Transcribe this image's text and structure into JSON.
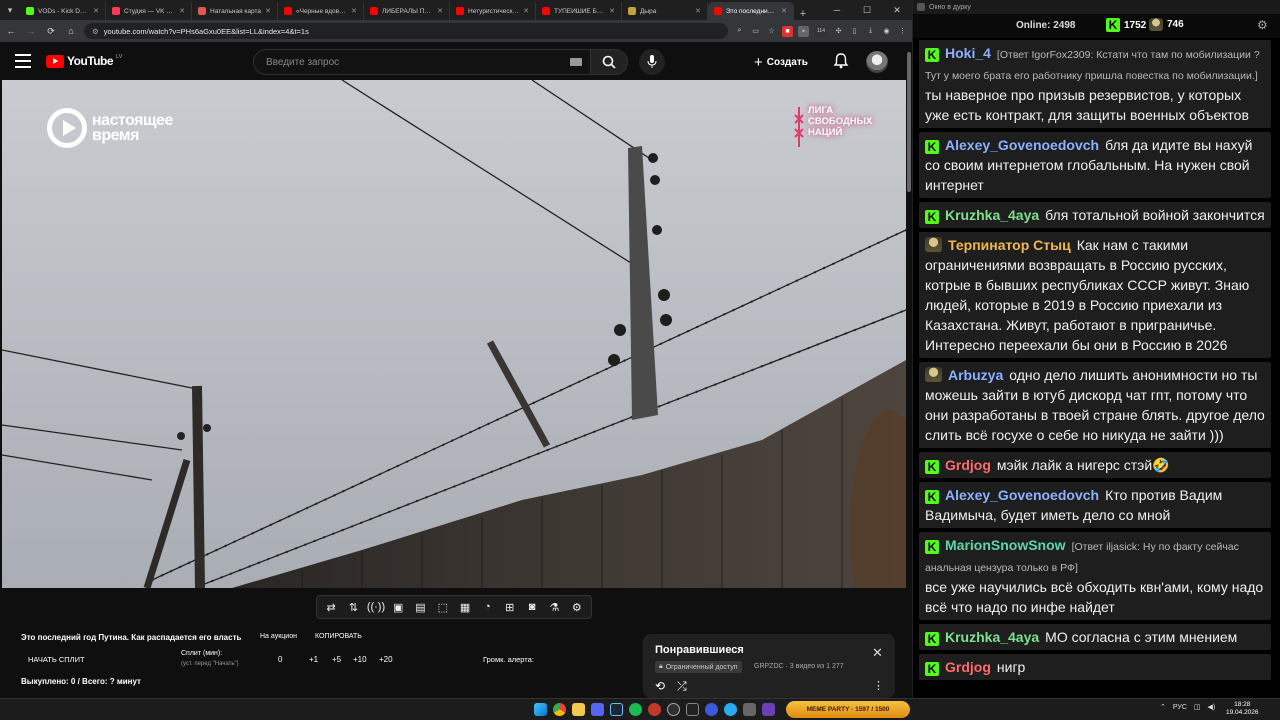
{
  "browser": {
    "tabs": [
      {
        "label": "VODs - Kick Dashb",
        "color": "#53fc18"
      },
      {
        "label": "Студия — VK Видео",
        "color": "#ff3b5c"
      },
      {
        "label": "Натальная карта",
        "color": "#e05757"
      },
      {
        "label": "«Черные вдовы»",
        "color": "#ff0000"
      },
      {
        "label": "ЛИБЕРАЛЫ ПРАВ",
        "color": "#ff0000"
      },
      {
        "label": "Нетуристический",
        "color": "#ff0000"
      },
      {
        "label": "ТУПЕЙШИЕ БЕЛЫ",
        "color": "#ff0000"
      },
      {
        "label": "Дыра",
        "color": "#c9a13b"
      },
      {
        "label": "Это последний го",
        "color": "#ff0000",
        "active": true
      }
    ],
    "url": "youtube.com/watch?v=PHs6aGxu0EE&list=LL&index=4&t=1s",
    "ext_badge": "114"
  },
  "youtube": {
    "logo": "YouTube",
    "logo_region": "LV",
    "search_placeholder": "Введите запрос",
    "create_label": "Создать"
  },
  "video": {
    "logo_left": "настоящее время",
    "logo_right": "ЛИГА СВОБОДНЫХ НАЦИЙ"
  },
  "panel": {
    "title": "Это последний год Путина. Как распадается его власть",
    "auction": "На аукцион",
    "copy": "КОПИРОВАТЬ",
    "start_split": "НАЧАТЬ СПЛИТ",
    "split_label": "Сплит (мин):",
    "split_sub": "(уст. перед \"Начать\")",
    "split_value": "0",
    "inc": [
      "+1",
      "+5",
      "+10",
      "+20"
    ],
    "alert_volume": "Громк. алерта:",
    "sold": "Выкуплено: 0 / Всего: ? минут"
  },
  "liked": {
    "title": "Понравившиеся",
    "access": "Ограниченный доступ",
    "meta": "GRPZDC · 3 видео из 1 277"
  },
  "chat": {
    "window_title": "Окно в дурку",
    "online_label": "Online:",
    "online": "2498",
    "kick_count": "1752",
    "tw_count": "746",
    "messages": [
      {
        "badge": "k",
        "nick": "Hoki_4",
        "color": "#8db0ff",
        "reply": "[Ответ IgorFox2309: Кстати что там по мобилизации ? Тут у моего брата его работнику пришла повестка по мобилизации.]",
        "text": "ты наверное про призыв резервистов, у которых уже есть контракт, для защиты военных объектов"
      },
      {
        "badge": "k",
        "nick": "Alexey_Govenoedovch",
        "color": "#8db0ff",
        "reply": "",
        "text": "бля да идите вы нахуй со своим интернетом глобальным. На нужен свой интернет"
      },
      {
        "badge": "k",
        "nick": "Kruzhka_4aya",
        "color": "#7ee08f",
        "reply": "",
        "text": "бля тотальной войной закончится"
      },
      {
        "badge": "t",
        "nick": "Терпинатор Стыц",
        "color": "#f0b84a",
        "reply": "",
        "text": "Как нам с такими ограничениями возвращать в Россию русских, котрые в бывших республиках СССР живут. Знаю людей, которые в 2019 в Россию приехали из Казахстана. Живут, работают в приграничье. Интересно переехали бы они в Россию в 2026"
      },
      {
        "badge": "t",
        "nick": "Arbuzya",
        "color": "#8db0ff",
        "reply": "",
        "text": "одно дело лишить анонимности но ты можешь зайти в ютуб дискорд чат гпт, потому что они разработаны в твоей стране блять. другое дело слить всё госухе о себе но никуда не зайти )))"
      },
      {
        "badge": "k",
        "nick": "Grdjog",
        "color": "#ff6b6b",
        "reply": "",
        "text": "мэйк лайк а нигерс стэй🤣"
      },
      {
        "badge": "k",
        "nick": "Alexey_Govenoedovch",
        "color": "#8db0ff",
        "reply": "",
        "text": "Кто против Вадим Вадимыча, будет иметь дело со мной"
      },
      {
        "badge": "k",
        "nick": "MarionSnowSnow",
        "color": "#5fd6a8",
        "reply": "[Ответ iljasick: Ну по факту сейчас анальная цензура только в РФ]",
        "text": "все уже научились всё обходить квн'ами, кому надо всё что надо по инфе найдет"
      },
      {
        "badge": "k",
        "nick": "Kruzhka_4aya",
        "color": "#7ee08f",
        "reply": "",
        "text": "МО согласна с этим мнением"
      },
      {
        "badge": "k",
        "nick": "Grdjog",
        "color": "#ff6b6b",
        "reply": "",
        "text": "нигр"
      }
    ]
  },
  "taskbar": {
    "meme_party": "MEME PARTY · 1597 / 1500",
    "lang": "РУС",
    "time": "18:28",
    "date": "19.04.2026"
  }
}
